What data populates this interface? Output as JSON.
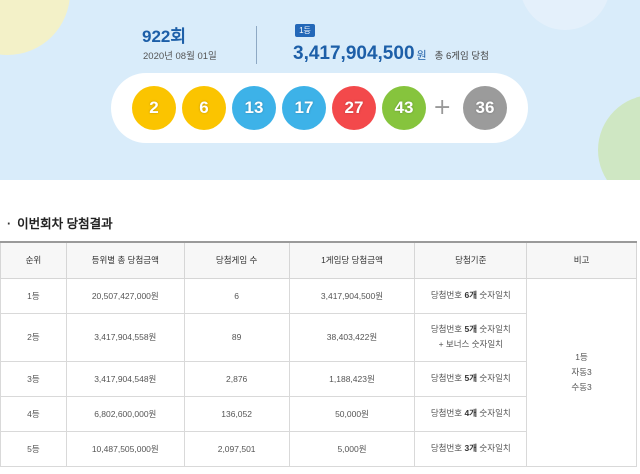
{
  "draw": {
    "number_label": "922회",
    "date": "2020년 08월 01일",
    "rank_badge": "1등",
    "first_prize": "3,417,904,500",
    "prize_unit": "원",
    "winner_note": "총 6게임 당첨",
    "numbers": [
      "2",
      "6",
      "13",
      "17",
      "27",
      "43"
    ],
    "plus": "+",
    "bonus": "36",
    "ball_colors": {
      "yellow": "#fbc400",
      "blue": "#3db2e8",
      "red": "#f3494b",
      "green": "#86c43d",
      "gray": "#9b9b9b"
    }
  },
  "results": {
    "title": "이번회차 당첨결과",
    "headers": [
      "순위",
      "등위별 총 당첨금액",
      "당첨게임 수",
      "1게임당 당첨금액",
      "당첨기준",
      "비고"
    ],
    "rows": [
      {
        "rank": "1등",
        "total": "20,507,427,000원",
        "games": "6",
        "per_game": "3,417,904,500원",
        "crit_a": "당첨번호 ",
        "crit_b": "6개",
        "crit_c": " 숫자일치",
        "crit2": ""
      },
      {
        "rank": "2등",
        "total": "3,417,904,558원",
        "games": "89",
        "per_game": "38,403,422원",
        "crit_a": "당첨번호 ",
        "crit_b": "5개",
        "crit_c": " 숫자일치",
        "crit2": "+ 보너스 숫자일치"
      },
      {
        "rank": "3등",
        "total": "3,417,904,548원",
        "games": "2,876",
        "per_game": "1,188,423원",
        "crit_a": "당첨번호 ",
        "crit_b": "5개",
        "crit_c": " 숫자일치",
        "crit2": ""
      },
      {
        "rank": "4등",
        "total": "6,802,600,000원",
        "games": "136,052",
        "per_game": "50,000원",
        "crit_a": "당첨번호 ",
        "crit_b": "4개",
        "crit_c": " 숫자일치",
        "crit2": ""
      },
      {
        "rank": "5등",
        "total": "10,487,505,000원",
        "games": "2,097,501",
        "per_game": "5,000원",
        "crit_a": "당첨번호 ",
        "crit_b": "3개",
        "crit_c": " 숫자일치",
        "crit2": ""
      }
    ],
    "note": {
      "line1": "1등",
      "line2": "자동3",
      "line3": "수동3"
    }
  }
}
